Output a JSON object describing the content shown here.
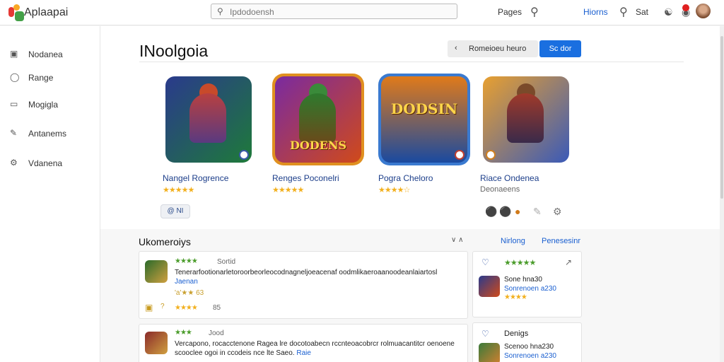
{
  "header": {
    "app_name": "Aplaapai",
    "search": {
      "value": "",
      "placeholder": "Ipdodoensh"
    },
    "links": {
      "pages": "Pages",
      "home": "Hiorns",
      "sat": "Sat"
    }
  },
  "sidebar": {
    "items": [
      {
        "label": "Nodanea",
        "icon": "monitor-icon"
      },
      {
        "label": "Range",
        "icon": "chat-icon"
      },
      {
        "label": "Mogigla",
        "icon": "folder-icon"
      },
      {
        "label": "Antanems",
        "icon": "pen-icon"
      },
      {
        "label": "Vdanena",
        "icon": "settings-icon"
      }
    ]
  },
  "main": {
    "title": "INoolgoia",
    "secondary_button": "Romeioeu heuro",
    "primary_button": "Sc dor",
    "games": [
      {
        "name": "Nangel Rogrence",
        "stars": "★★★★★",
        "subtitle": "",
        "colors": [
          "#2a3a8c",
          "#1e7a3a"
        ],
        "logo_text": ""
      },
      {
        "name": "Renges Poconelri",
        "stars": "★★★★★",
        "subtitle": "",
        "colors": [
          "#7a2aa0",
          "#d04a1a"
        ],
        "logo_text": "DODENS"
      },
      {
        "name": "Pogra Cheloro",
        "stars": "★★★★☆",
        "subtitle": "",
        "colors": [
          "#1a4aa0",
          "#e07a1a"
        ],
        "logo_text": "DODSIN"
      },
      {
        "name": "Riace Ondenea",
        "stars": "",
        "subtitle": "Deonaeens",
        "colors": [
          "#e8a030",
          "#3a5ab8"
        ],
        "logo_text": ""
      }
    ],
    "chip_text": "@ NI",
    "section_title": "Ukomeroiys",
    "section_links": [
      "Nirlong",
      "Penesesinr"
    ],
    "reviews": [
      {
        "stars": "★★★★",
        "author": "Sortid",
        "text": "Tenerarfootionarletoroorbeorleocodnagneljoeacenaf oodmlikaeroaanoodeanlaiartosl",
        "link": "Jaenan",
        "meta1": "'a'★★ 63",
        "meta2_stars": "★★★★",
        "meta2_count": "85",
        "thumb": [
          "#2a6a2a",
          "#d0a040"
        ]
      },
      {
        "stars": "★★★",
        "author": "Jood",
        "text": "Vercapono, rocacctenone Ragea lre docotoabecn rccnteoacobrcr rolmuacantitcr oenoene scooclee ogoi in ccodeis nce lte Saeo.",
        "link": "Raie",
        "thumb": [
          "#8a2a2a",
          "#d0a040"
        ]
      }
    ],
    "side_cards": [
      {
        "stars": "★★★★★",
        "line1": "Sone hna30",
        "line2": "Sonrenoen a230",
        "line3_stars": "★★★★",
        "thumb": [
          "#2a3a8c",
          "#d04a1a"
        ]
      },
      {
        "title": "Denigs",
        "line1": "Scenoo hna230",
        "line2": "Sonrenoen a230",
        "thumb": [
          "#3a7a3a",
          "#d08030"
        ]
      }
    ]
  }
}
